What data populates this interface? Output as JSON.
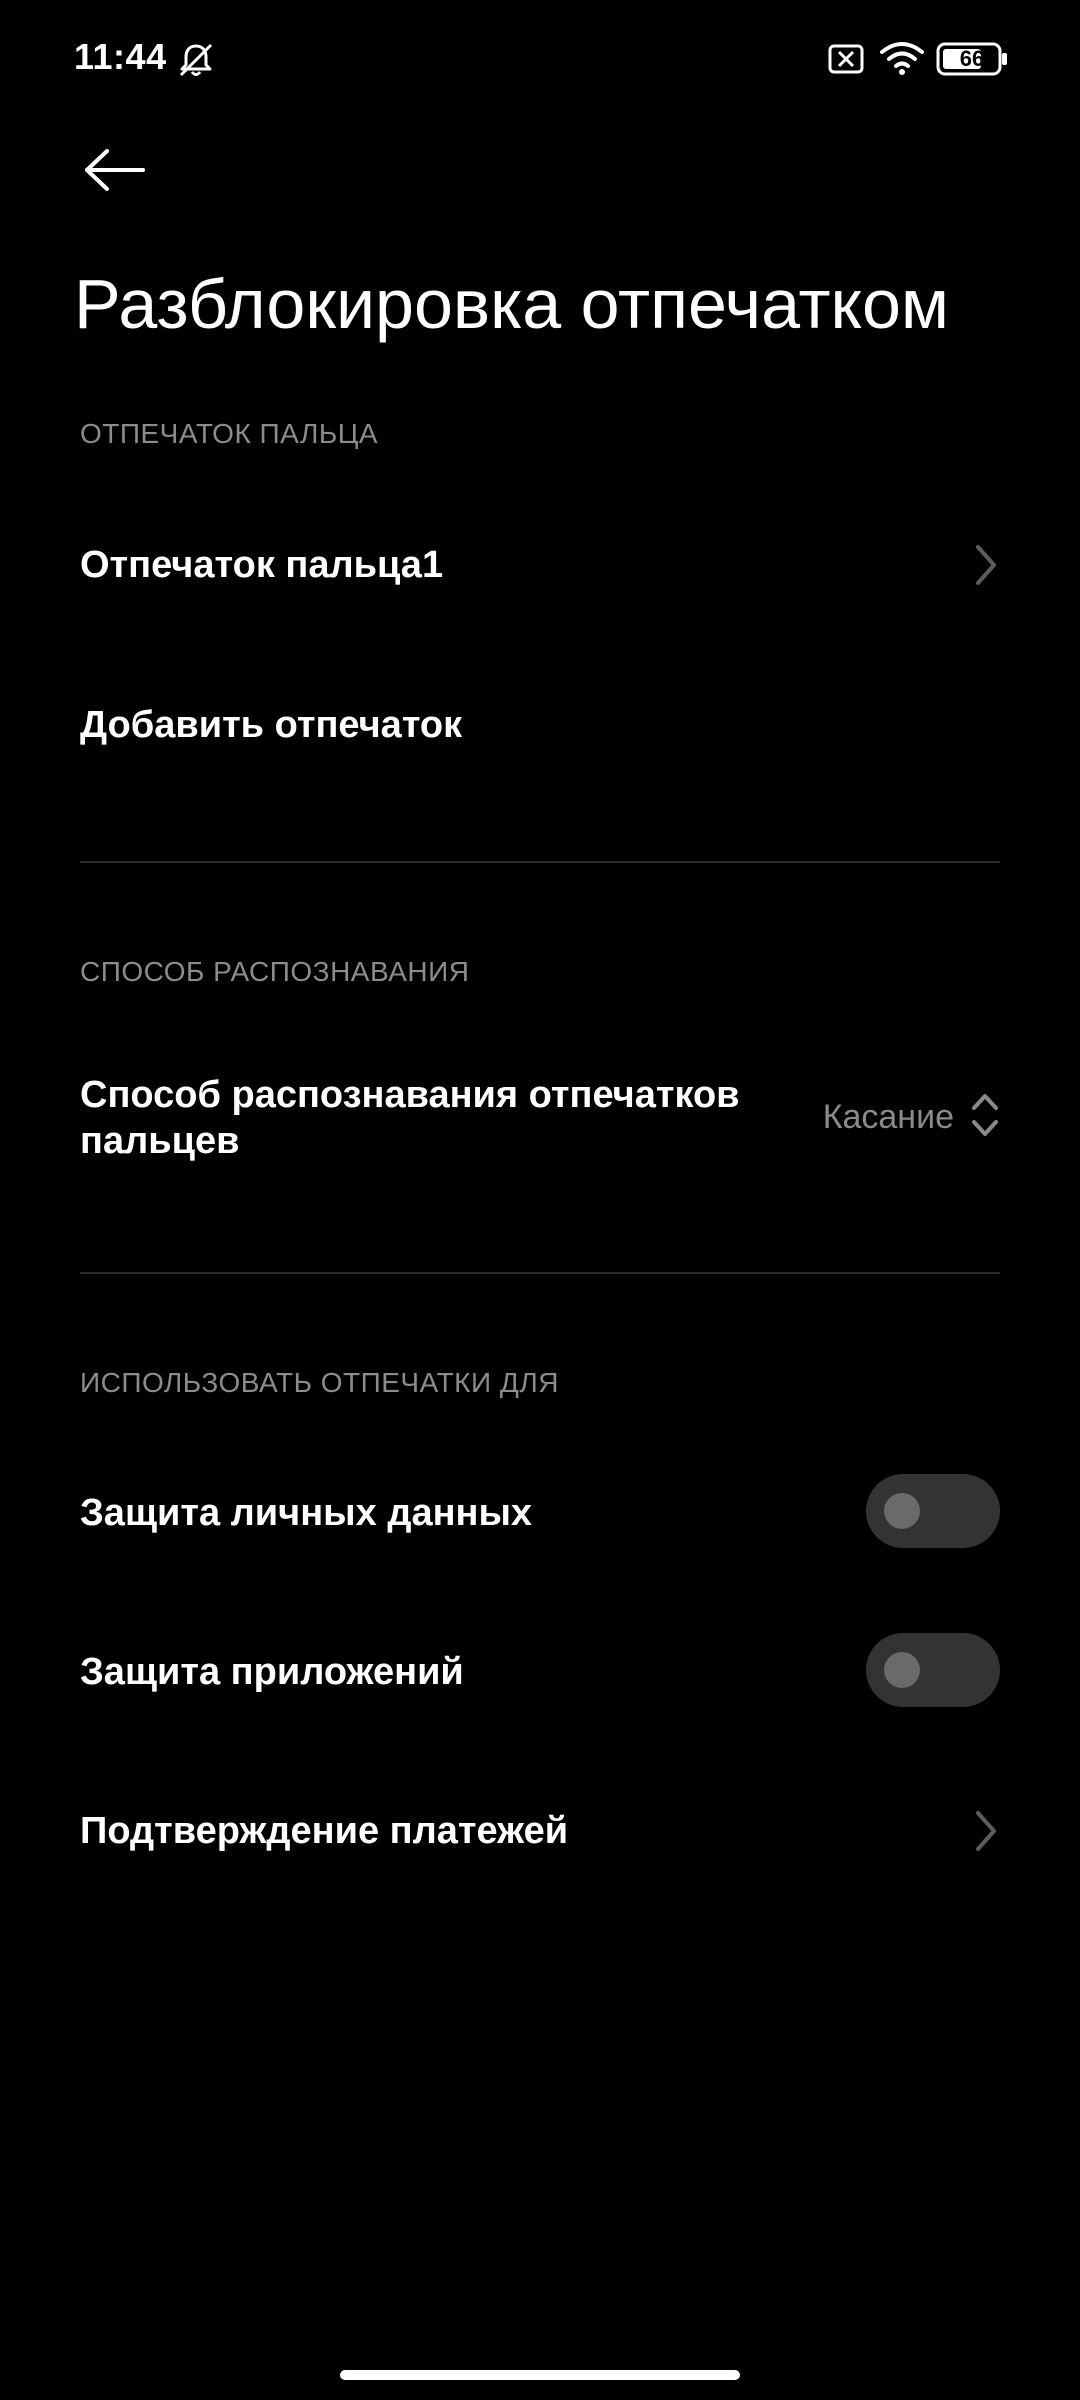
{
  "status_bar": {
    "time": "11:44",
    "battery_level": "66",
    "icons": [
      "bell-off-icon",
      "sim-x-icon",
      "wifi-icon",
      "battery-icon"
    ]
  },
  "header": {
    "back_icon": "arrow-left-icon",
    "title": "Разблокировка отпечатком"
  },
  "sections": {
    "fingerprint": {
      "header": "ОТПЕЧАТОК ПАЛЬЦА",
      "items": [
        {
          "label": "Отпечаток пальца1",
          "has_chevron": true
        },
        {
          "label": "Добавить отпечаток",
          "has_chevron": false
        }
      ]
    },
    "recognition": {
      "header": "СПОСОБ РАСПОЗНАВАНИЯ",
      "item": {
        "label": "Способ распознавания отпечатков пальцев",
        "value": "Касание"
      }
    },
    "use_for": {
      "header": "ИСПОЛЬЗОВАТЬ ОТПЕЧАТКИ ДЛЯ",
      "items": [
        {
          "label": "Защита личных данных",
          "control": "toggle",
          "on": false
        },
        {
          "label": "Защита приложений",
          "control": "toggle",
          "on": false
        },
        {
          "label": "Подтверждение платежей",
          "control": "chevron"
        }
      ]
    }
  },
  "colors": {
    "background": "#000000",
    "text_primary": "#ffffff",
    "text_secondary": "#8c8c8c",
    "toggle_track_off": "#333333",
    "toggle_knob_off": "#6a6a6a"
  }
}
